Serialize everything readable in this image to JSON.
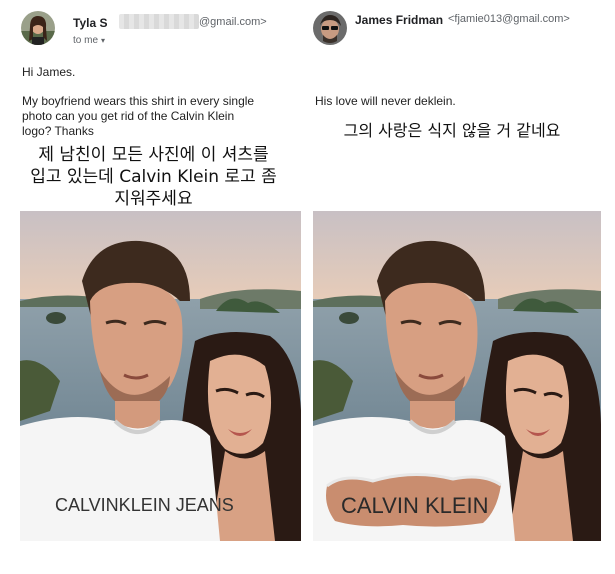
{
  "left": {
    "sender_name": "Tyla S",
    "sender_email": "@gmail.com>",
    "to_label": "to me",
    "greeting": "Hi James.",
    "message_lines": [
      "My boyfriend wears this shirt in every single",
      "photo can you get rid of the Calvin Klein",
      "logo? Thanks"
    ],
    "korean_lines": [
      "제 남친이 모든 사진에 이 셔츠를",
      "입고 있는데 Calvin Klein 로고 좀",
      "지워주세요"
    ],
    "shirt_text": "CALVINKLEIN JEANS"
  },
  "right": {
    "sender_name": "James Fridman",
    "sender_email": "<fjamie013@gmail.com>",
    "message": "His love will never deklein.",
    "korean": "그의 사랑은 식지 않을 거 같네요",
    "shirt_text": "CALVIN KLEIN"
  },
  "icons": {
    "left_avatar": "user-avatar",
    "right_avatar": "user-avatar",
    "to_me_caret": "caret-down-icon"
  }
}
